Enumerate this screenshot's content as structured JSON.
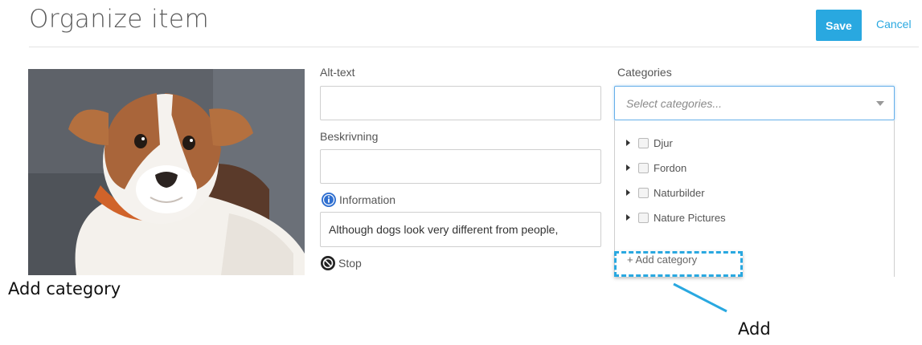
{
  "header": {
    "title": "Organize item",
    "save_label": "Save",
    "cancel_label": "Cancel"
  },
  "form": {
    "alt_text_label": "Alt-text",
    "alt_text_value": "",
    "description_label": "Beskrivning",
    "description_value": "",
    "information_label": "Information",
    "information_value": "Although dogs look very different from people,",
    "stop_label": "Stop"
  },
  "categories": {
    "label": "Categories",
    "placeholder": "Select categories...",
    "items": [
      {
        "label": "Djur",
        "checked": false,
        "expandable": true
      },
      {
        "label": "Fordon",
        "checked": false,
        "expandable": true
      },
      {
        "label": "Naturbilder",
        "checked": false,
        "expandable": true
      },
      {
        "label": "Nature Pictures",
        "checked": false,
        "expandable": true
      }
    ],
    "add_category_label": "+ Add category"
  },
  "annotations": {
    "left_caption": "Add category",
    "callout_label": "Add"
  },
  "colors": {
    "accent": "#29a8e0",
    "info_icon": "#2f6fd0",
    "stop_icon": "#222222"
  },
  "icons": {
    "info": "info-icon",
    "stop": "stop-icon",
    "select_caret": "chevron-down-icon",
    "tree_caret": "caret-right-icon"
  }
}
